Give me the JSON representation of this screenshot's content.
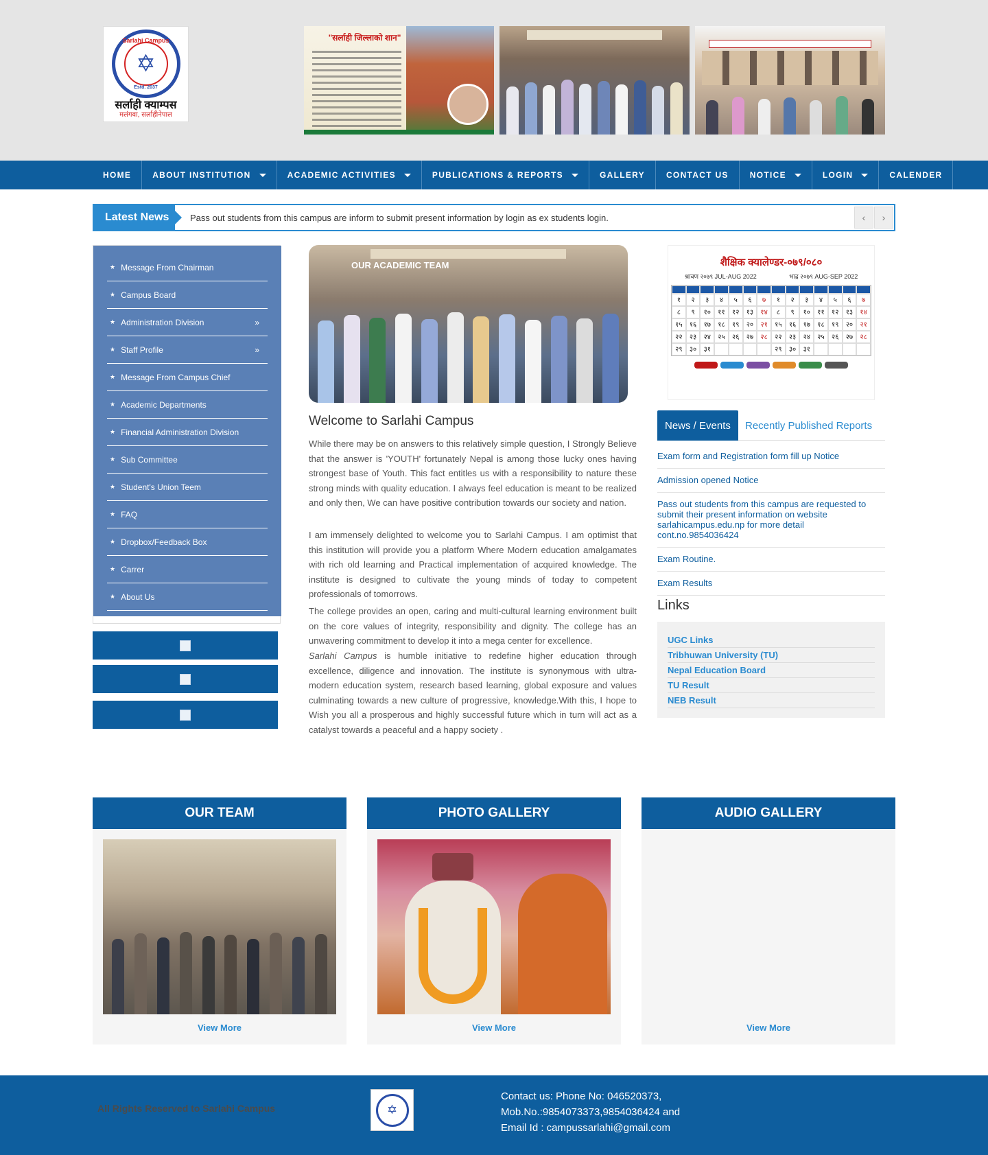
{
  "header": {
    "logo_text": "Sarlahi Campus",
    "logo_subtext": "Malangwa, Sarlahi (Nepal)",
    "logo_estd": "Estd. 2037",
    "logo_nepali": "सर्लाही क्याम्पस",
    "logo_nepali_sub": "मलंगवा, सर्लाहीनेपाल",
    "banner1_title": "\"सर्लाही जिल्लाको शान\""
  },
  "nav": {
    "items": [
      {
        "label": "HOME",
        "dropdown": false
      },
      {
        "label": "ABOUT INSTITUTION",
        "dropdown": true
      },
      {
        "label": "ACADEMIC ACTIVITIES",
        "dropdown": true
      },
      {
        "label": "PUBLICATIONS & REPORTS",
        "dropdown": true
      },
      {
        "label": "GALLERY",
        "dropdown": false
      },
      {
        "label": "CONTACT US",
        "dropdown": false
      },
      {
        "label": "NOTICE",
        "dropdown": true
      },
      {
        "label": "LOGIN",
        "dropdown": true
      },
      {
        "label": "CALENDER",
        "dropdown": false
      }
    ]
  },
  "ticker": {
    "label": "Latest News",
    "text": "Pass out students from this campus are inform to submit present information by login as ex students login."
  },
  "sidebar": {
    "items": [
      {
        "label": "Message From Chairman",
        "has_sub": false
      },
      {
        "label": "Campus Board",
        "has_sub": false
      },
      {
        "label": "Administration Division",
        "has_sub": true
      },
      {
        "label": "Staff Profile",
        "has_sub": true
      },
      {
        "label": "Message From Campus Chief",
        "has_sub": false
      },
      {
        "label": "Academic Departments",
        "has_sub": false
      },
      {
        "label": "Financial Administration Division",
        "has_sub": false
      },
      {
        "label": "Sub Committee",
        "has_sub": false
      },
      {
        "label": "Student's Union Teem",
        "has_sub": false
      },
      {
        "label": "FAQ",
        "has_sub": false
      },
      {
        "label": "Dropbox/Feedback Box",
        "has_sub": false
      },
      {
        "label": "Carrer",
        "has_sub": false
      },
      {
        "label": "About Us",
        "has_sub": false
      }
    ],
    "sub_marker": "»"
  },
  "main": {
    "hero_caption": "OUR ACADEMIC TEAM",
    "welcome_title": "Welcome to Sarlahi Campus",
    "para1": "While there may be on answers to this relatively simple question, I Strongly Believe that the answer is 'YOUTH' fortunately Nepal is among those lucky ones having strongest base of Youth. This fact entitles us with a responsibility to nature these strong minds with quality education. I always feel education is meant to be realized and only then, We can have positive contribution towards our society and nation.",
    "para2": "I am immensely delighted to welcome you to Sarlahi Campus. I am optimist that this institution will provide you a platform Where Modern education amalgamates with rich old learning and Practical implementation of acquired knowledge. The institute is designed to cultivate the young minds of today to competent professionals of tomorrows.",
    "para3": "The college provides an open, caring and multi-cultural learning environment built on the core values of integrity, responsibility and dignity. The college has an unwavering commitment to develop it into a mega center for excellence.",
    "para4_em": "Sarlahi Campus",
    "para4": " is humble initiative to redefine higher education through excellence, diligence and innovation. The institute is synonymous with ultra-modern education system, research based learning, global exposure and values culminating towards a new culture of progressive, knowledge.With this, I hope to Wish you all a prosperous and highly successful future which in turn will act as a catalyst towards a peaceful and a happy society ."
  },
  "calendar": {
    "title": "शैक्षिक क्यालेण्डर-०७९/०८०",
    "month1": "श्रावण २०७९   JUL-AUG 2022",
    "month2": "भाद्र २०७९   AUG-SEP 2022"
  },
  "tabs": {
    "active": "News / Events",
    "inactive": "Recently Published Reports"
  },
  "news": [
    "Exam form and Registration form fill up Notice",
    "Admission opened Notice",
    "Pass out students from this campus are requested to submit their present information on website sarlahicampus.edu.np for more detail cont.no.9854036424",
    "Exam Routine.",
    "Exam Results"
  ],
  "links": {
    "title": "Links",
    "items": [
      "UGC Links",
      "Tribhuwan University (TU)",
      "Nepal Education Board",
      "TU Result",
      "NEB Result"
    ]
  },
  "cards": [
    {
      "title": "OUR TEAM",
      "more": "View More"
    },
    {
      "title": "PHOTO GALLERY",
      "more": "View More"
    },
    {
      "title": "AUDIO GALLERY",
      "more": "View More"
    }
  ],
  "footer": {
    "rights": "All Rights Reserved to Sarlahi Campus",
    "contact_line1": "Contact us: Phone No: 046520373,",
    "contact_line2": "Mob.No.:9854073373,9854036424 and",
    "contact_line3": "Email Id : campussarlahi@gmail.com"
  },
  "colors": {
    "primary": "#0e5e9e",
    "accent": "#2a8bd0",
    "sidebar": "#5a80b6",
    "header_bg": "#e5e5e5"
  }
}
